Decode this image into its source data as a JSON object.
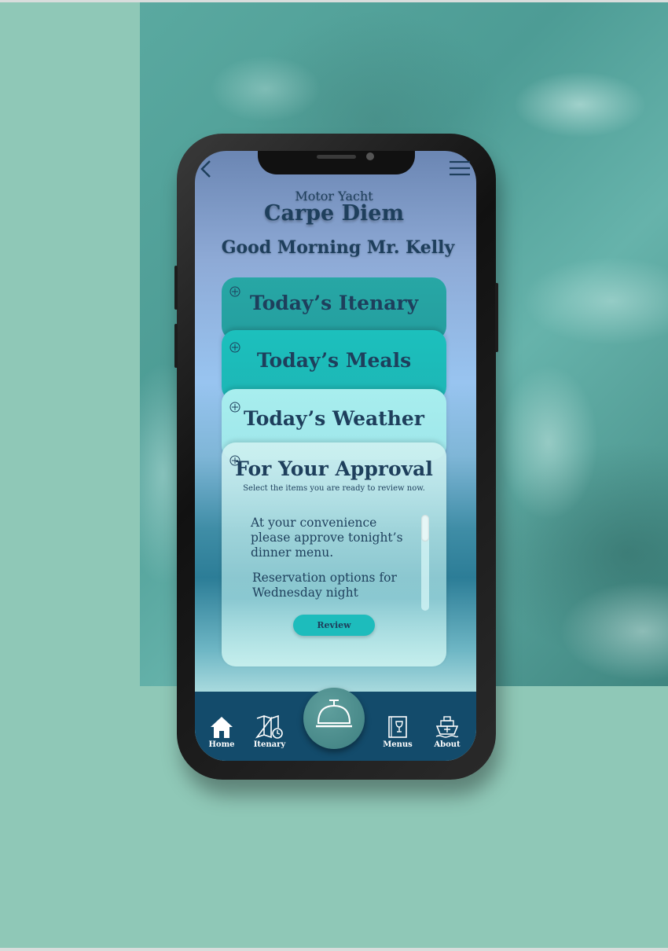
{
  "header": {
    "subtitle": "Motor Yacht",
    "title": "Carpe Diem",
    "greeting": "Good Morning Mr. Kelly"
  },
  "cards": {
    "itinerary": {
      "title": "Today’s Itenary"
    },
    "meals": {
      "title": "Today’s Meals"
    },
    "weather": {
      "title": "Today’s Weather"
    },
    "approval": {
      "title": "For Your Approval",
      "subtitle": "Select the items you are ready to review now.",
      "items": [
        "At your convenience please approve tonight’s dinner menu.",
        "Reservation options for Wednesday night"
      ],
      "button_label": "Review"
    }
  },
  "tabbar": {
    "items": [
      {
        "label": "Home",
        "icon": "home-icon"
      },
      {
        "label": "Itenary",
        "icon": "map-clock-icon"
      },
      {
        "label": "Menus",
        "icon": "menu-book-icon"
      },
      {
        "label": "About",
        "icon": "yacht-icon"
      }
    ],
    "center_icon": "service-bell-icon"
  },
  "colors": {
    "background": "#8fc8b7",
    "text_primary": "#1e3f5c",
    "tabbar": "#134b6b",
    "accent_teal": "#1dbcbc"
  }
}
